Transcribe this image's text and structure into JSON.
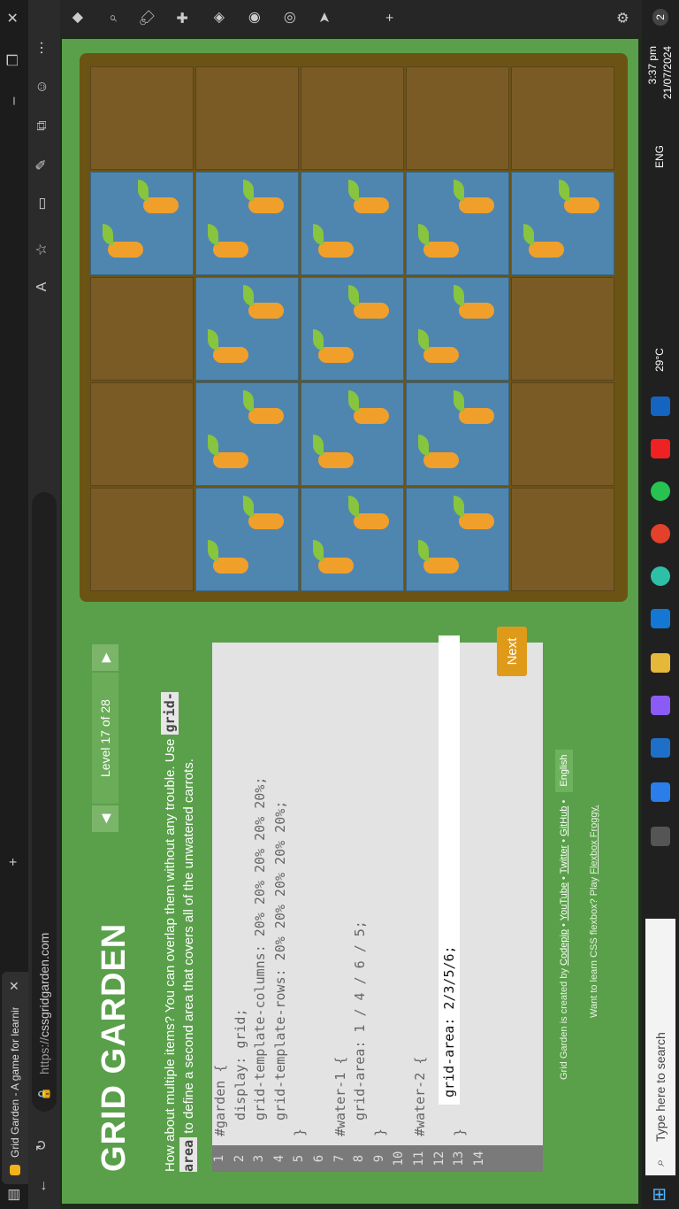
{
  "browser": {
    "tab_title": "Grid Garden - A game for learnin",
    "new_tab": "+",
    "url_prefix": "https://",
    "url_host": "cssgridgarden.com"
  },
  "page": {
    "logo": "GRID GARDEN",
    "level_label": "Level 17 of 28",
    "description_before": "How about multiple items? You can overlap them without any trouble. Use ",
    "description_code": "grid-area",
    "description_after": " to define a second area that covers all of the unwatered carrots.",
    "gutter": [
      "1",
      "2",
      "3",
      "4",
      "5",
      "6",
      "7",
      "8",
      "9",
      "10",
      "11",
      "12",
      "13",
      "14"
    ],
    "code_lines": [
      "#garden {",
      "  display: grid;",
      "  grid-template-columns: 20% 20% 20% 20% 20%;",
      "  grid-template-rows: 20% 20% 20% 20% 20%;",
      "}",
      "",
      "#water-1 {",
      "  grid-area: 1 / 4 / 6 / 5;",
      "}",
      "",
      "#water-2 {",
      "",
      "}",
      ""
    ],
    "answer_value": "grid-area: 2/3/5/6;",
    "next_label": "Next",
    "credits_text": "Grid Garden is created by ",
    "credits_links": [
      "Codepip",
      "YouTube",
      "Twitter",
      "GitHub"
    ],
    "language": "English",
    "promo_text": "Want to learn CSS flexbox? Play ",
    "promo_link": "Flexbox Froggy."
  },
  "garden": {
    "rows": 5,
    "cols": 5,
    "watered": [
      [
        0,
        3
      ],
      [
        1,
        3
      ],
      [
        2,
        3
      ],
      [
        3,
        3
      ],
      [
        4,
        3
      ],
      [
        1,
        2
      ],
      [
        1,
        1
      ],
      [
        1,
        0
      ],
      [
        2,
        2
      ],
      [
        2,
        1
      ],
      [
        2,
        0
      ],
      [
        3,
        2
      ],
      [
        3,
        1
      ],
      [
        3,
        0
      ]
    ]
  },
  "taskbar": {
    "search_placeholder": "Type here to search",
    "weather": "29°C",
    "language": "ENG",
    "time": "3:37 pm",
    "date": "21/07/2024",
    "notifications": "2"
  }
}
